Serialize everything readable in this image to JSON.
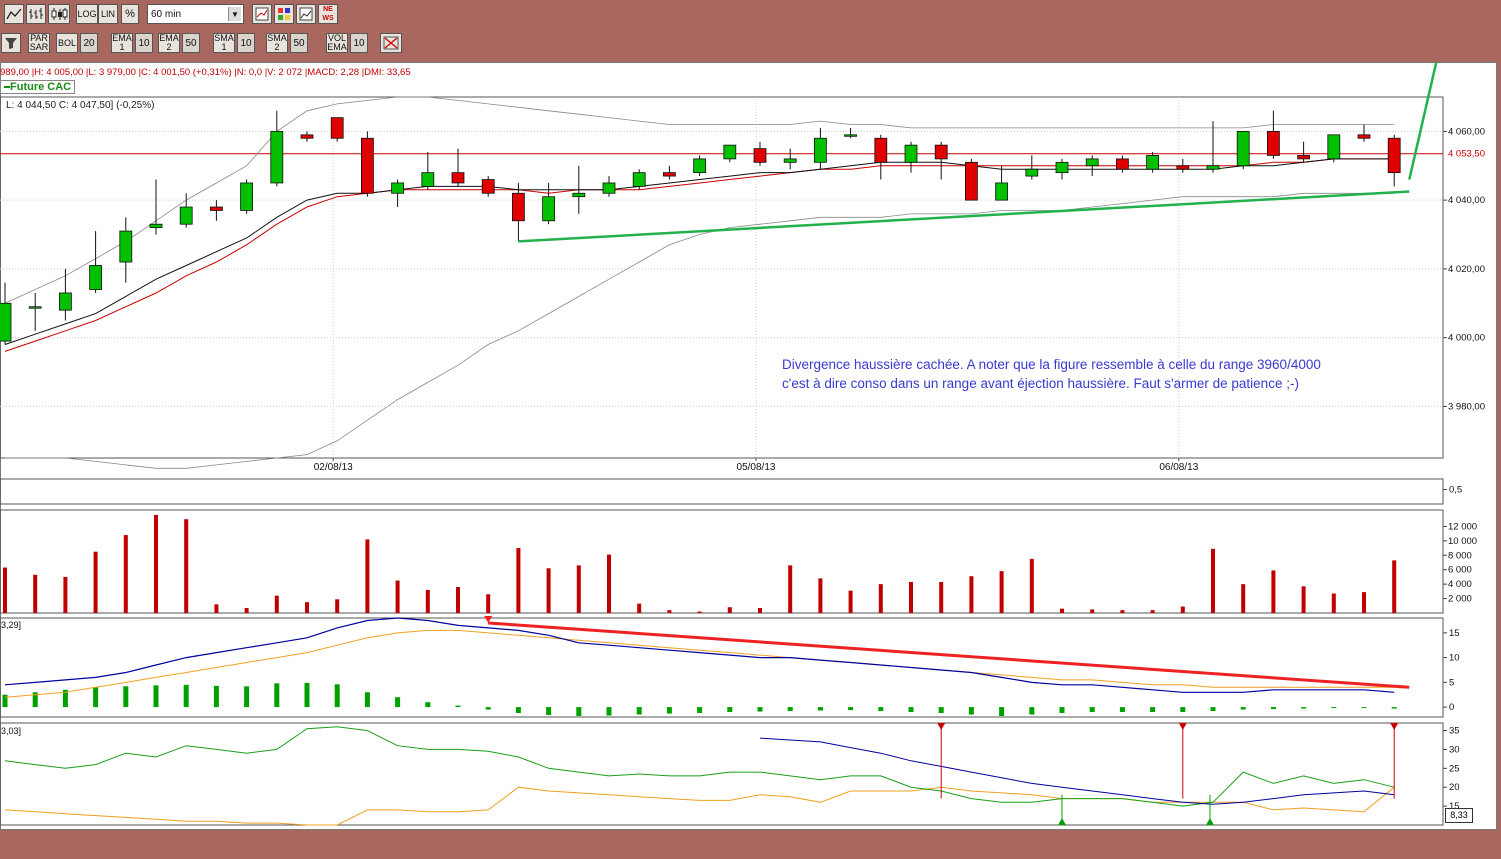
{
  "toolbar1": {
    "buttons": [
      {
        "name": "line-chart-button",
        "label": ""
      },
      {
        "name": "bar-chart-button",
        "label": ""
      },
      {
        "name": "candlestick-button",
        "label": ""
      },
      {
        "name": "log-button",
        "label": "LOG"
      },
      {
        "name": "lin-button",
        "label": "LIN"
      },
      {
        "name": "percent-button",
        "label": "%"
      }
    ],
    "timeframe": "60 min",
    "right_buttons": [
      "compare-icon",
      "palette-icon",
      "chart-icon",
      "news-icon"
    ],
    "news_label": "NE WS"
  },
  "toolbar2": {
    "items": [
      {
        "name": "filter-button",
        "label": ""
      },
      {
        "name": "parsar-button",
        "label": "PAR SAR"
      },
      {
        "name": "bol-button",
        "label": "BOL"
      },
      {
        "name": "bol-period",
        "label": "20"
      },
      {
        "name": "ema1-button",
        "label": "EMA 1"
      },
      {
        "name": "ema1-period",
        "label": "10"
      },
      {
        "name": "ema2-button",
        "label": "EMA 2"
      },
      {
        "name": "ema2-period",
        "label": "50"
      },
      {
        "name": "sma1-button",
        "label": "SMA 1"
      },
      {
        "name": "sma1-period",
        "label": "10"
      },
      {
        "name": "sma2-button",
        "label": "SMA 2"
      },
      {
        "name": "sma2-period",
        "label": "50"
      },
      {
        "name": "volema-button",
        "label": "VOL EMA"
      },
      {
        "name": "volema-period",
        "label": "10"
      }
    ]
  },
  "info": {
    "ohlc_line": "989,00 |H: 4 005,00 |L: 3 979,00 |C: 4 001,50 (+0,31%) |N: 0,0 |V: 2 072 |MACD: 2,28 |DMI: 33,65",
    "instrument": "Future CAC",
    "last_line": "L: 4 044,50  C: 4 047,50] (-0,25%)",
    "osc_label": "0,5",
    "macd_label": "3,29]",
    "dmi_label": "3,03]",
    "dmi_value_box": "8,33"
  },
  "annotation": {
    "line1": "Divergence haussière cachée. A noter que la figure ressemble à celle du range 3960/4000",
    "line2": "c'est à dire conso dans un range avant éjection haussière. Faut s'armer de patience ;-)"
  },
  "colors": {
    "bull": "#00c000",
    "bear": "#e00000",
    "annotation_text": "#3a3ad0",
    "trendline": "#22b14c",
    "resistance": "#cc0000",
    "macd_line": "#0000a0",
    "signal_line": "#f0a020",
    "divergence_line": "#ee2222",
    "dmi_plus": "#18a018",
    "dmi_minus": "#f0a020",
    "adx": "#0000a0",
    "volume": "#c00000"
  },
  "chart_data": [
    {
      "type": "candlestick",
      "title": "Future CAC",
      "x_labels": [
        "02/08/13",
        "05/08/13",
        "06/08/13"
      ],
      "ylim": [
        3965,
        4070
      ],
      "yticks": [
        3980,
        4000,
        4020,
        4040,
        4060
      ],
      "ytick_labels": [
        "3 980,00",
        "4 000,00",
        "4 020,00",
        "4 040,00",
        "4 060,00"
      ],
      "last_price_label": "4 053,50",
      "last_price": 4053.5,
      "candles": [
        {
          "o": 3999,
          "h": 4016,
          "l": 3998,
          "c": 4010
        },
        {
          "o": 4009,
          "h": 4013,
          "l": 4002,
          "c": 4009
        },
        {
          "o": 4008,
          "h": 4020,
          "l": 4005,
          "c": 4013
        },
        {
          "o": 4014,
          "h": 4031,
          "l": 4013,
          "c": 4021
        },
        {
          "o": 4022,
          "h": 4035,
          "l": 4016,
          "c": 4031
        },
        {
          "o": 4032,
          "h": 4046,
          "l": 4030,
          "c": 4033
        },
        {
          "o": 4033,
          "h": 4042,
          "l": 4032,
          "c": 4038
        },
        {
          "o": 4038,
          "h": 4040,
          "l": 4034,
          "c": 4037
        },
        {
          "o": 4037,
          "h": 4046,
          "l": 4036,
          "c": 4045
        },
        {
          "o": 4045,
          "h": 4066,
          "l": 4044,
          "c": 4060
        },
        {
          "o": 4059,
          "h": 4060,
          "l": 4057,
          "c": 4058
        },
        {
          "o": 4064,
          "h": 4064,
          "l": 4057,
          "c": 4058
        },
        {
          "o": 4058,
          "h": 4060,
          "l": 4041,
          "c": 4042
        },
        {
          "o": 4042,
          "h": 4046,
          "l": 4038,
          "c": 4045
        },
        {
          "o": 4044,
          "h": 4054,
          "l": 4043,
          "c": 4048
        },
        {
          "o": 4048,
          "h": 4055,
          "l": 4044,
          "c": 4045
        },
        {
          "o": 4046,
          "h": 4047,
          "l": 4041,
          "c": 4042
        },
        {
          "o": 4042,
          "h": 4045,
          "l": 4028,
          "c": 4034
        },
        {
          "o": 4034,
          "h": 4045,
          "l": 4033,
          "c": 4041
        },
        {
          "o": 4041,
          "h": 4050,
          "l": 4036,
          "c": 4042
        },
        {
          "o": 4042,
          "h": 4047,
          "l": 4041,
          "c": 4045
        },
        {
          "o": 4044,
          "h": 4049,
          "l": 4043,
          "c": 4048
        },
        {
          "o": 4048,
          "h": 4050,
          "l": 4046,
          "c": 4047
        },
        {
          "o": 4048,
          "h": 4053,
          "l": 4047,
          "c": 4052
        },
        {
          "o": 4052,
          "h": 4056,
          "l": 4051,
          "c": 4056
        },
        {
          "o": 4055,
          "h": 4057,
          "l": 4050,
          "c": 4051
        },
        {
          "o": 4051,
          "h": 4055,
          "l": 4049,
          "c": 4052
        },
        {
          "o": 4051,
          "h": 4061,
          "l": 4049,
          "c": 4058
        },
        {
          "o": 4059,
          "h": 4061,
          "l": 4058,
          "c": 4059
        },
        {
          "o": 4058,
          "h": 4059,
          "l": 4046,
          "c": 4051
        },
        {
          "o": 4051,
          "h": 4057,
          "l": 4048,
          "c": 4056
        },
        {
          "o": 4056,
          "h": 4057,
          "l": 4046,
          "c": 4052
        },
        {
          "o": 4051,
          "h": 4052,
          "l": 4040,
          "c": 4040
        },
        {
          "o": 4040,
          "h": 4050,
          "l": 4040,
          "c": 4045
        },
        {
          "o": 4047,
          "h": 4053,
          "l": 4046,
          "c": 4049
        },
        {
          "o": 4048,
          "h": 4052,
          "l": 4046,
          "c": 4051
        },
        {
          "o": 4050,
          "h": 4053,
          "l": 4047,
          "c": 4052
        },
        {
          "o": 4052,
          "h": 4053,
          "l": 4048,
          "c": 4049
        },
        {
          "o": 4049,
          "h": 4054,
          "l": 4048,
          "c": 4053
        },
        {
          "o": 4050,
          "h": 4052,
          "l": 4048,
          "c": 4049
        },
        {
          "o": 4049,
          "h": 4063,
          "l": 4048,
          "c": 4050
        },
        {
          "o": 4050,
          "h": 4060,
          "l": 4049,
          "c": 4060
        },
        {
          "o": 4060,
          "h": 4066,
          "l": 4052,
          "c": 4053
        },
        {
          "o": 4053,
          "h": 4057,
          "l": 4051,
          "c": 4052
        },
        {
          "o": 4052,
          "h": 4059,
          "l": 4051,
          "c": 4059
        },
        {
          "o": 4059,
          "h": 4062,
          "l": 4057,
          "c": 4058
        },
        {
          "o": 4058,
          "h": 4059,
          "l": 4044,
          "c": 4048
        }
      ],
      "ema1": [
        3998,
        4001,
        4004,
        4007,
        4012,
        4017,
        4021,
        4025,
        4029,
        4035,
        4040,
        4042,
        4042,
        4043,
        4044,
        4044,
        4044,
        4043,
        4043,
        4043,
        4043,
        4044,
        4045,
        4046,
        4047,
        4048,
        4048,
        4049,
        4050,
        4051,
        4051,
        4051,
        4050,
        4049,
        4049,
        4049,
        4049,
        4049,
        4049,
        4049,
        4049,
        4050,
        4050,
        4051,
        4052,
        4052,
        4052
      ],
      "ema2": [
        3996,
        3999,
        4002,
        4005,
        4009,
        4013,
        4018,
        4022,
        4027,
        4033,
        4038,
        4041,
        4042,
        4043,
        4043,
        4043,
        4043,
        4043,
        4042,
        4043,
        4043,
        4043,
        4044,
        4045,
        4046,
        4047,
        4048,
        4049,
        4049,
        4050,
        4050,
        4050,
        4050,
        4050,
        4050,
        4050,
        4050,
        4050,
        4050,
        4050,
        4050,
        4050,
        4051,
        4051,
        4052,
        4052,
        4052
      ],
      "boll_upper": [
        4010,
        4014,
        4018,
        4023,
        4028,
        4034,
        4040,
        4045,
        4050,
        4060,
        4066,
        4068,
        4069,
        4070,
        4070,
        4069,
        4068,
        4067,
        4066,
        4065,
        4064,
        4063,
        4062,
        4062,
        4062,
        4062,
        4062,
        4063,
        4062,
        4062,
        4061,
        4061,
        4061,
        4061,
        4061,
        4061,
        4061,
        4061,
        4061,
        4061,
        4061,
        4061,
        4062,
        4062,
        4062,
        4062,
        4062
      ],
      "boll_lower": [
        3965,
        3965,
        3965,
        3964,
        3963,
        3962,
        3962,
        3963,
        3964,
        3965,
        3966,
        3970,
        3976,
        3982,
        3987,
        3992,
        3998,
        4002,
        4007,
        4012,
        4017,
        4022,
        4027,
        4030,
        4032,
        4033,
        4034,
        4035,
        4035,
        4035,
        4036,
        4036,
        4036,
        4037,
        4037,
        4037,
        4038,
        4039,
        4040,
        4041,
        4041,
        4041,
        4041,
        4042,
        4042,
        4042,
        4042
      ],
      "trendline": {
        "x": [
          17,
          46.5
        ],
        "y": [
          4028,
          4042.5
        ]
      },
      "breakout_line": {
        "x": [
          46.5,
          47.6
        ],
        "y": [
          4046,
          4088
        ]
      }
    },
    {
      "type": "line",
      "name": "oscillator",
      "ytick_labels": [
        "0,5"
      ]
    },
    {
      "type": "bar",
      "name": "volume",
      "ylim": [
        0,
        14000
      ],
      "yticks": [
        2000,
        4000,
        6000,
        8000,
        10000,
        12000
      ],
      "ytick_labels": [
        "2 000",
        "4 000",
        "6 000",
        "8 000",
        "10 000",
        "12 000"
      ],
      "values": [
        6300,
        5300,
        5000,
        8500,
        10800,
        13600,
        13000,
        1200,
        700,
        2400,
        1500,
        1900,
        10200,
        4500,
        3200,
        3600,
        2600,
        9000,
        6200,
        6600,
        8100,
        1300,
        400,
        200,
        800,
        700,
        6600,
        4800,
        3100,
        4000,
        4300,
        4300,
        5100,
        5800,
        7500,
        600,
        500,
        400,
        400,
        900,
        8900,
        4000,
        5900,
        3700,
        2700,
        2900,
        7300
      ]
    },
    {
      "type": "line",
      "name": "MACD",
      "ylim": [
        -2,
        18
      ],
      "yticks": [
        0,
        5,
        10,
        15
      ],
      "ytick_labels": [
        "0",
        "5",
        "10",
        "15"
      ],
      "macd": [
        4.5,
        5,
        5.5,
        6,
        7,
        8.5,
        10,
        11,
        12,
        13,
        14,
        16,
        17.5,
        18,
        17.5,
        16.5,
        16,
        15.5,
        14.5,
        13,
        12.5,
        12,
        11.5,
        11,
        10.5,
        10,
        10,
        9.5,
        9,
        8.5,
        8,
        7.5,
        7,
        6,
        5,
        4.5,
        4.5,
        4,
        3.5,
        3,
        3,
        3,
        3.5,
        3.5,
        3.5,
        3.5,
        3
      ],
      "signal": [
        2,
        2.5,
        3,
        4,
        5,
        6,
        7,
        8,
        9,
        10,
        11,
        12.5,
        14,
        15,
        15.5,
        15.5,
        15,
        14.5,
        14,
        13.5,
        13,
        12.5,
        12,
        11.5,
        11,
        10.5,
        10,
        9.5,
        9,
        8.5,
        8,
        7.5,
        7,
        6.5,
        6,
        5.5,
        5.5,
        5,
        4.5,
        4.5,
        4,
        4,
        4,
        4,
        4,
        4,
        4
      ],
      "histogram": [
        2.5,
        3,
        3.5,
        4,
        4.2,
        4.4,
        4.5,
        4.3,
        4.2,
        4.8,
        4.9,
        4.6,
        3,
        2,
        1,
        0.3,
        -0.5,
        -1.2,
        -1.6,
        -1.8,
        -1.7,
        -1.5,
        -1.3,
        -1.2,
        -1,
        -0.9,
        -0.8,
        -0.7,
        -0.6,
        -0.8,
        -1,
        -1.2,
        -1.5,
        -1.8,
        -1.5,
        -1.2,
        -1,
        -1,
        -1,
        -1,
        -0.8,
        -0.5,
        -0.4,
        -0.3,
        -0.2,
        -0.2,
        -0.3
      ],
      "divergence_line": {
        "x": [
          16,
          46.5
        ],
        "y": [
          17,
          4
        ]
      }
    },
    {
      "type": "line",
      "name": "DMI",
      "ylim": [
        10,
        37
      ],
      "yticks": [
        15,
        20,
        25,
        30,
        35
      ],
      "ytick_labels": [
        "15",
        "20",
        "25",
        "30",
        "35"
      ],
      "di_plus": [
        27,
        26,
        25,
        26,
        29,
        28,
        31,
        30,
        29,
        30,
        35.5,
        36,
        35,
        31,
        30,
        30,
        29.5,
        28,
        25,
        24,
        23,
        23.5,
        23,
        23,
        24,
        24,
        23,
        22,
        23,
        23,
        20,
        19,
        17,
        16,
        16,
        17,
        17,
        17,
        16,
        15,
        16,
        24,
        21,
        23,
        21,
        22,
        20
      ],
      "di_minus": [
        14,
        13.5,
        13,
        12.5,
        12,
        11.5,
        11,
        11,
        10.5,
        10.5,
        10,
        10,
        14,
        14,
        13.5,
        13.5,
        14,
        20,
        19,
        18.5,
        18,
        17.5,
        17,
        16.5,
        16.5,
        18,
        17.5,
        16,
        19,
        19,
        19,
        20,
        19,
        18.5,
        18,
        17,
        17,
        17,
        16,
        16,
        16,
        16,
        14,
        14.5,
        14,
        13.5,
        20
      ],
      "adx": [
        null,
        null,
        null,
        null,
        null,
        null,
        null,
        null,
        null,
        null,
        null,
        null,
        null,
        null,
        null,
        null,
        null,
        null,
        null,
        null,
        null,
        null,
        null,
        null,
        null,
        33,
        32.5,
        32,
        30.5,
        29,
        27,
        25.5,
        24,
        22.5,
        21,
        20,
        19,
        18,
        17,
        16,
        15.5,
        16,
        17,
        18,
        18.5,
        19,
        18
      ]
    }
  ]
}
